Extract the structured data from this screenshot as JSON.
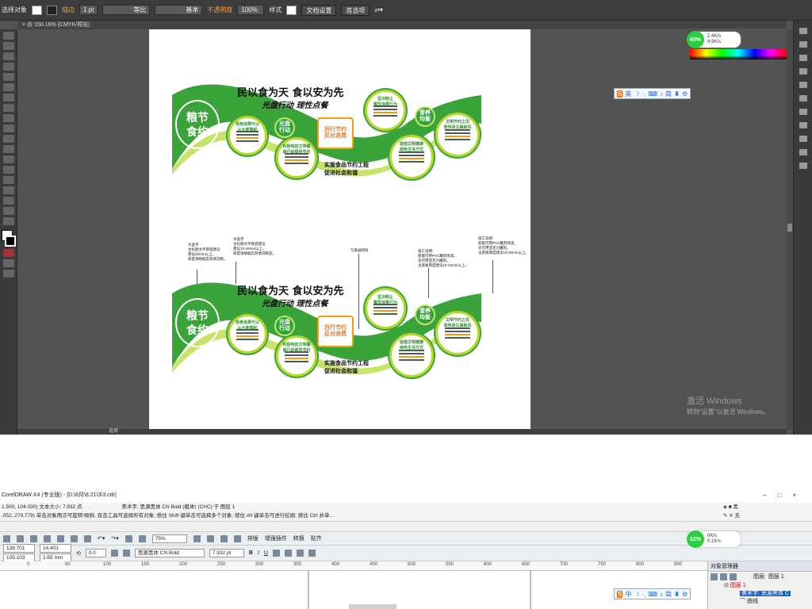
{
  "illustrator": {
    "control_bar": {
      "selection_label": "选择对象",
      "stroke_label": "描边",
      "stroke_weight": "1 pt",
      "stroke_style": "等比",
      "brush_style": "基本",
      "opacity_label": "不透明度",
      "opacity_value": "100%",
      "style_label": "样式",
      "doc_setup_button": "文档设置",
      "preferences_button": "首选项"
    },
    "doc_tab": "@ 150.16% (CMYK/预览)",
    "hscroll_label": "选择",
    "network_widget": {
      "percent": "65%",
      "up": "2.4K/s",
      "down": "4.9K/s"
    },
    "ime_toolbar": {
      "items": [
        "英",
        "·",
        "ə",
        "⌨",
        "⚙",
        "简",
        "⚙"
      ]
    },
    "windows_activation": {
      "line1": "激活 Windows",
      "line2": "转到“设置”以激活 Windows。"
    },
    "artwork": {
      "title_line1": "民以食为天 食以安为先",
      "title_line2": "光盘行动 理性点餐",
      "seal_text": "粮节\n食约",
      "green_bubbles": [
        "光盘\n行动",
        "营养\n均衡"
      ],
      "orange_badge": "厉行节约\n反对浪费",
      "circle_titles": [
        "拒绝浪费可以\n从大家做起",
        "积极响应文明餐\n桌行动倡导节约",
        "坚决制止\n餐饮浪费行为",
        "文明节约之风\n既传承又展新风",
        "提倡文明健康\n绿色生活方式"
      ],
      "slogan_lines": [
        "实施食品节约工程",
        "促进社会和谐"
      ],
      "notes": [
        "水晶字\n主标题文字厚度建议\n建议30mm以上。\n厚度请根据实际情况制。",
        "水晶字\n主标题文字厚度建议\n建议10-20mm以上。\n厚度请根据实际情况制造。",
        "写真画喷绘",
        "施工说明:\n底版可用PVC雕刻喷漆。\n也可用亚克力雕刻。\n主底板厚度建议10-20mm以上。",
        "施工说明:\n底版可用PVC雕刻喷漆。\n也可用亚克力雕刻。\n主底板厚度建议10-20mm以上。"
      ]
    }
  },
  "coreldraw": {
    "title": "CorelDRAW X4 (专业版) - [D:\\8月\\8.21\\3\\3.cdr]",
    "status_row1_left": "1.500, 104.030)  文本大小: 7.932 点",
    "status_row1_mid": "美术字: 思源黑体 CN Bold (粗体) (CHC) 于 图层 1",
    "status_row2": ".052, 279.779)    单击对象两次可旋转/倾斜; 双击工具可选择所有对象; 按住 Shift 键单击可选择多个对象; 按住 Alt 键单击可进行挖掘; 按住 Ctrl 并单...",
    "fill_label": "黑",
    "outline_label": "无",
    "zoom": "75%",
    "menu_items": [
      "排版",
      "增强插件",
      "转换",
      "贴齐"
    ],
    "coords": {
      "x": "138.701 mm",
      "y": "105.103 mm",
      "w": "14.401 mm",
      "h": "2.65 mm"
    },
    "rotation": "0.0",
    "font_name": "思源黑体 CN Bold",
    "font_size": "7.932 pt",
    "ruler_ticks": [
      "0",
      "50",
      "100",
      "150",
      "200",
      "250",
      "300",
      "350",
      "400",
      "450",
      "500",
      "550",
      "600",
      "650",
      "700",
      "750",
      "800",
      "850"
    ],
    "object_manager": {
      "title": "对象管理器",
      "page_label": "图层:",
      "page_value": "图层 1",
      "layer": "图层 1",
      "selected_item": "美术字: 思源黑体 C",
      "item2": "曲线"
    },
    "network_widget": {
      "percent": "62%",
      "up": "0K/s",
      "down": "0.1K/s"
    }
  }
}
